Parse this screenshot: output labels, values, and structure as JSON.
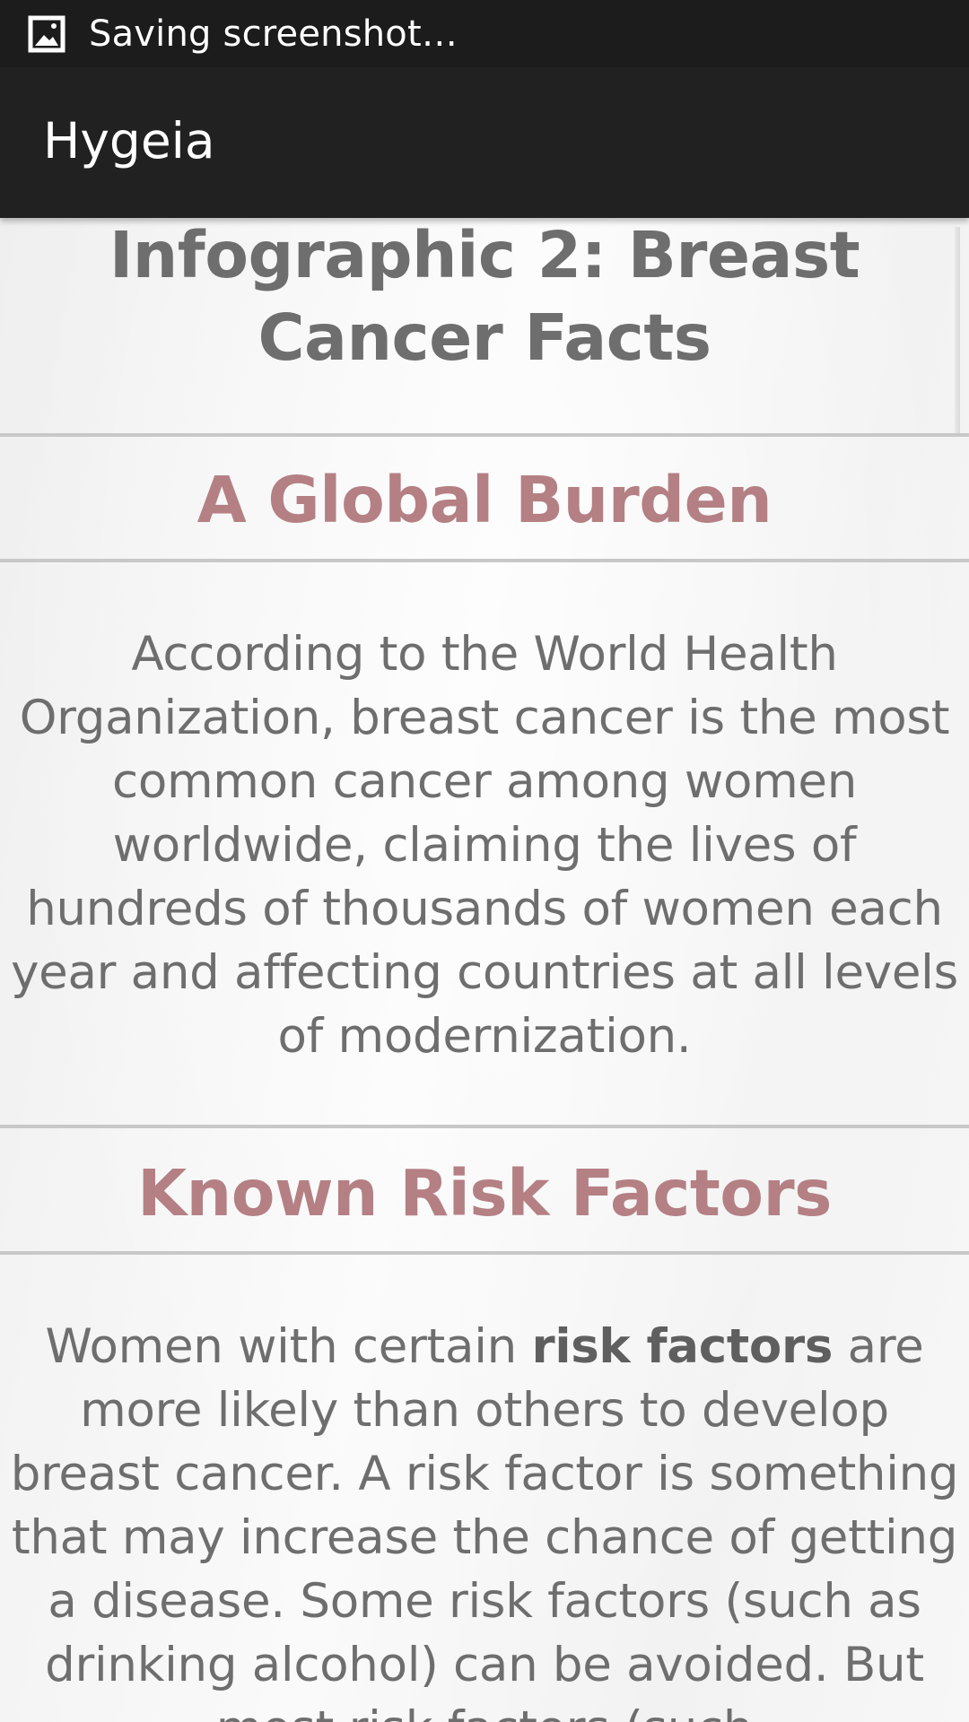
{
  "status_bar": {
    "icon": "image-icon",
    "text": "Saving screenshot…"
  },
  "app_bar": {
    "title": "Hygeia"
  },
  "page": {
    "title": "Infographic 2: Breast Cancer Facts"
  },
  "sections": [
    {
      "heading": "A Global Burden",
      "body": "According to the World Health Organization, breast cancer is the most common cancer among women worldwide, claiming the lives of hundreds of thousands of women each year and affecting countries at all levels of modernization."
    },
    {
      "heading": "Known Risk Factors",
      "body_before_bold": "Women with certain ",
      "body_bold": "risk factors",
      "body_after_bold": " are more likely than others to develop breast cancer. A risk factor is something that may increase the chance of getting a disease. Some risk factors (such as drinking alcohol) can be avoided. But most risk factors (such"
    }
  ],
  "colors": {
    "status_bar_bg": "#1c1c1c",
    "app_bar_bg": "#212121",
    "heading_accent": "#b48084",
    "body_text": "#6e6e6e",
    "divider": "#c8c8c8"
  }
}
